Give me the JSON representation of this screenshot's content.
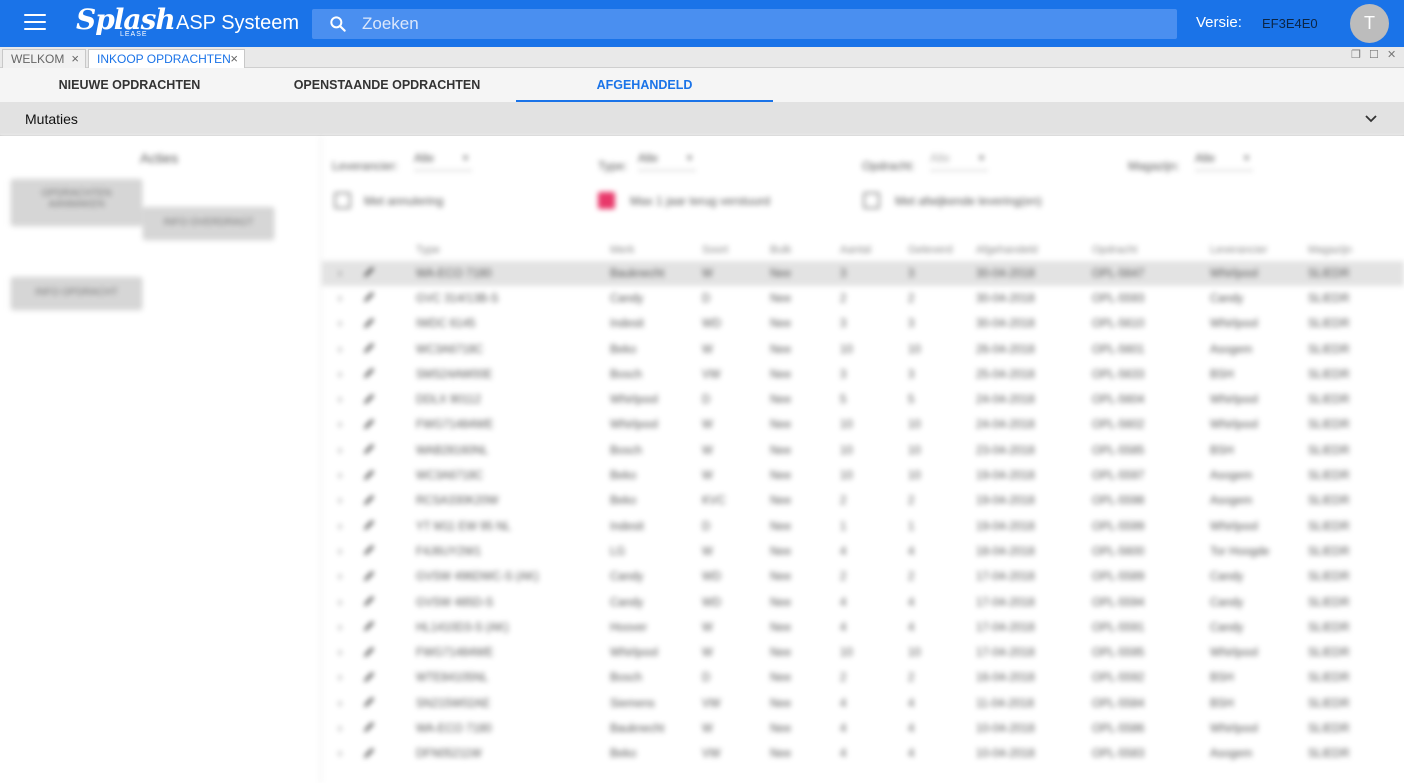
{
  "app": {
    "logo_text": "Splash",
    "logo_sub": "LEASE",
    "title": "ASP Systeem",
    "search_placeholder": "Zoeken",
    "version_label": "Versie:",
    "version_value": "EF3E4E0",
    "user_initial": "T"
  },
  "doc_tabs": [
    {
      "label": "WELKOM"
    },
    {
      "label": "INKOOP OPDRACHTEN"
    }
  ],
  "sub_tabs": [
    {
      "label": "NIEUWE OPDRACHTEN"
    },
    {
      "label": "OPENSTAANDE OPDRACHTEN"
    },
    {
      "label": "AFGEHANDELD"
    }
  ],
  "section": {
    "title": "Mutaties"
  },
  "actions": {
    "title": "Acties",
    "btn_1": "OPDRACHTEN AANMAKEN",
    "btn_2": "INFO OVERDRAGT",
    "btn_3": "INFO OPDRACHT"
  },
  "filters": {
    "leverancier_label": "Leverancier:",
    "leverancier_value": "Alle",
    "type_label": "Type:",
    "type_value": "Alle",
    "opdracht_label": "Opdracht:",
    "opdracht_value": "Alle",
    "magazijn_label": "Magazijn:",
    "magazijn_value": "Alle",
    "cb1_label": "Met annulering",
    "cb2_label": "Max 1 jaar terug verstuurd",
    "cb3_label": "Met afwijkende levering(en)"
  },
  "table": {
    "columns": [
      "Type",
      "Merk",
      "Soort",
      "Bulk",
      "Aantal",
      "Geleverd",
      "Afgehandeld",
      "Opdracht",
      "Leverancier",
      "Magazijn"
    ],
    "rows": [
      [
        "WA-ECO 7180",
        "Bauknecht",
        "W",
        "Nee",
        "3",
        "3",
        "30-04-2018",
        "OPL-5647",
        "Whirlpool",
        "SLIEDR"
      ],
      [
        "GVC 314/13B-S",
        "Candy",
        "D",
        "Nee",
        "2",
        "2",
        "30-04-2018",
        "OPL-5593",
        "Candy",
        "SLIEDR"
      ],
      [
        "IWDC 6145",
        "Indesit",
        "WD",
        "Nee",
        "3",
        "3",
        "30-04-2018",
        "OPL-5610",
        "Whirlpool",
        "SLIEDR"
      ],
      [
        "WC3A6718C",
        "Beko",
        "W",
        "Nee",
        "10",
        "10",
        "26-04-2018",
        "OPL-5601",
        "Asogem",
        "SLIEDR"
      ],
      [
        "SMS24AW00E",
        "Bosch",
        "VW",
        "Nee",
        "3",
        "3",
        "25-04-2018",
        "OPL-5633",
        "BSH",
        "SLIEDR"
      ],
      [
        "DDLX 90112",
        "Whirlpool",
        "D",
        "Nee",
        "5",
        "5",
        "24-04-2018",
        "OPL-5604",
        "Whirlpool",
        "SLIEDR"
      ],
      [
        "FWG71484WE",
        "Whirlpool",
        "W",
        "Nee",
        "10",
        "10",
        "24-04-2018",
        "OPL-5602",
        "Whirlpool",
        "SLIEDR"
      ],
      [
        "WAB28160NL",
        "Bosch",
        "W",
        "Nee",
        "10",
        "10",
        "23-04-2018",
        "OPL-5585",
        "BSH",
        "SLIEDR"
      ],
      [
        "WC3A6718C",
        "Beko",
        "W",
        "Nee",
        "10",
        "10",
        "19-04-2018",
        "OPL-5597",
        "Asogem",
        "SLIEDR"
      ],
      [
        "RCSA330K20W",
        "Beko",
        "KVC",
        "Nee",
        "2",
        "2",
        "19-04-2018",
        "OPL-5598",
        "Asogem",
        "SLIEDR"
      ],
      [
        "YT M11 EW 95 NL",
        "Indesit",
        "D",
        "Nee",
        "1",
        "1",
        "19-04-2018",
        "OPL-5599",
        "Whirlpool",
        "SLIEDR"
      ],
      [
        "F4J6UY2W1",
        "LG",
        "W",
        "Nee",
        "4",
        "4",
        "18-04-2018",
        "OPL-5600",
        "Tor Hoogde",
        "SLIEDR"
      ],
      [
        "GVSW 496DWC-S (AK)",
        "Candy",
        "WD",
        "Nee",
        "2",
        "2",
        "17-04-2018",
        "OPL-5589",
        "Candy",
        "SLIEDR"
      ],
      [
        "GVSW 485D-S",
        "Candy",
        "WD",
        "Nee",
        "4",
        "4",
        "17-04-2018",
        "OPL-5594",
        "Candy",
        "SLIEDR"
      ],
      [
        "HL1410D3-S (AK)",
        "Hoover",
        "W",
        "Nee",
        "4",
        "4",
        "17-04-2018",
        "OPL-5591",
        "Candy",
        "SLIEDR"
      ],
      [
        "FWG71484WE",
        "Whirlpool",
        "W",
        "Nee",
        "10",
        "10",
        "17-04-2018",
        "OPL-5595",
        "Whirlpool",
        "SLIEDR"
      ],
      [
        "WTE84105NL",
        "Bosch",
        "D",
        "Nee",
        "2",
        "2",
        "16-04-2018",
        "OPL-5592",
        "BSH",
        "SLIEDR"
      ],
      [
        "SN215W02AE",
        "Siemens",
        "VW",
        "Nee",
        "4",
        "4",
        "11-04-2018",
        "OPL-5584",
        "BSH",
        "SLIEDR"
      ],
      [
        "WA-ECO 7180",
        "Bauknecht",
        "W",
        "Nee",
        "4",
        "4",
        "10-04-2018",
        "OPL-5586",
        "Whirlpool",
        "SLIEDR"
      ],
      [
        "DFN05211W",
        "Beko",
        "VW",
        "Nee",
        "4",
        "4",
        "10-04-2018",
        "OPL-5583",
        "Asogem",
        "SLIEDR"
      ]
    ]
  }
}
